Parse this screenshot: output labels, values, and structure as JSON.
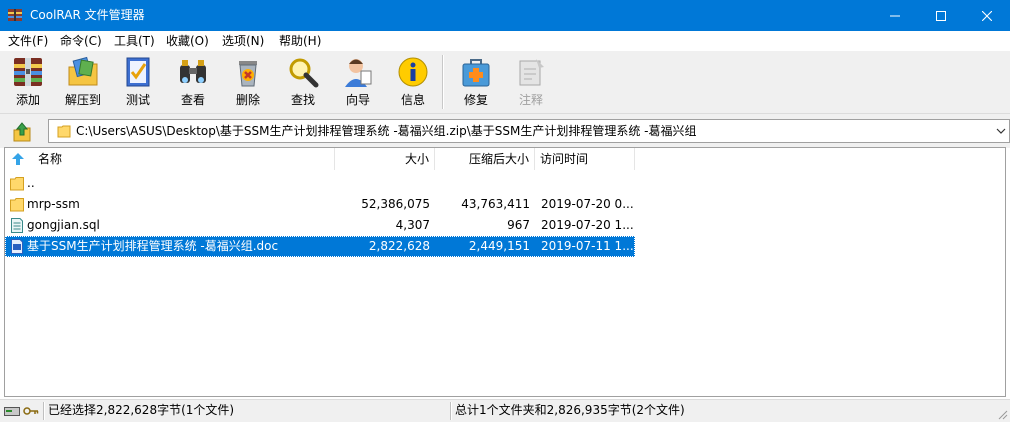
{
  "window": {
    "title": "CoolRAR 文件管理器"
  },
  "menu": [
    "文件(F)",
    "命令(C)",
    "工具(T)",
    "收藏(O)",
    "选项(N)",
    "帮助(H)"
  ],
  "toolbar": {
    "add": "添加",
    "extract": "解压到",
    "test": "测试",
    "view": "查看",
    "delete": "删除",
    "find": "查找",
    "wizard": "向导",
    "info": "信息",
    "repair": "修复",
    "comment": "注释"
  },
  "address": {
    "path": "C:\\Users\\ASUS\\Desktop\\基于SSM生产计划排程管理系统 -葛福兴组.zip\\基于SSM生产计划排程管理系统 -葛福兴组"
  },
  "columns": {
    "name": "名称",
    "size": "大小",
    "packed": "压缩后大小",
    "accessed": "访问时间"
  },
  "files": [
    {
      "name": "..",
      "size": "",
      "packed": "",
      "accessed": "",
      "icon": "folder-icon",
      "selected": false
    },
    {
      "name": "mrp-ssm",
      "size": "52,386,075",
      "packed": "43,763,411",
      "accessed": "2019-07-20 0...",
      "icon": "folder-icon",
      "selected": false
    },
    {
      "name": "gongjian.sql",
      "size": "4,307",
      "packed": "967",
      "accessed": "2019-07-20 1...",
      "icon": "text-file-icon",
      "selected": false
    },
    {
      "name": "基于SSM生产计划排程管理系统 -葛福兴组.doc",
      "size": "2,822,628",
      "packed": "2,449,151",
      "accessed": "2019-07-11 1...",
      "icon": "doc-file-icon",
      "selected": true
    }
  ],
  "status": {
    "left": "已经选择2,822,628字节(1个文件)",
    "right": "总计1个文件夹和2,826,935字节(2个文件)"
  },
  "colors": {
    "titlebar": "#0078d7",
    "selection": "#0078d7",
    "folder": "#ffd86b"
  }
}
